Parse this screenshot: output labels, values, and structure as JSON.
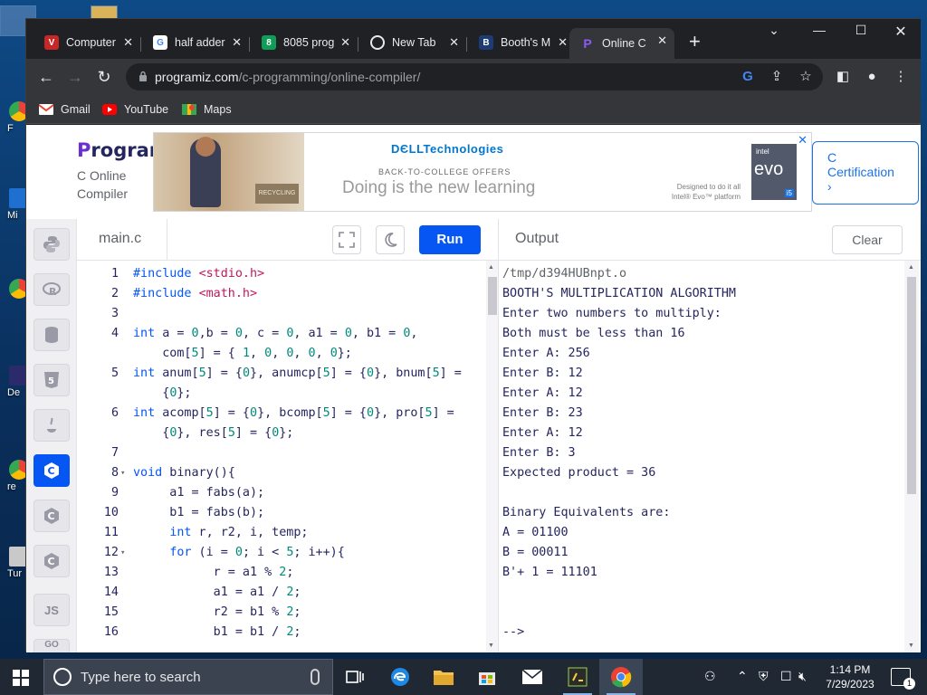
{
  "desktop": {
    "icon_labels": [
      "F",
      "Mi",
      "De",
      "re",
      "Tur"
    ]
  },
  "tabs": [
    {
      "label": "Computer",
      "favicon": "V",
      "color": "#d93025"
    },
    {
      "label": "half adder",
      "favicon": "G",
      "color": "#4285f4"
    },
    {
      "label": "8085 prog",
      "favicon": "8",
      "color": "#0f9d58"
    },
    {
      "label": "New Tab",
      "favicon": "chrome",
      "color": "#e8eaed"
    },
    {
      "label": "Booth's M",
      "favicon": "B",
      "color": "#1f3b73"
    },
    {
      "label": "Online C C",
      "favicon": "P",
      "color": "#6a2fd1"
    }
  ],
  "address": {
    "domain": "programiz.com",
    "path": "/c-programming/online-compiler/"
  },
  "bookmarks": [
    {
      "label": "Gmail"
    },
    {
      "label": "YouTube"
    },
    {
      "label": "Maps"
    }
  ],
  "brand": {
    "logo_p": "P",
    "logo_rest": "rogramiz",
    "subtitle_1": "C Online",
    "subtitle_2": "Compiler"
  },
  "ad": {
    "brand": "DЄLLTechnologies",
    "offer": "BACK-TO-COLLEGE OFFERS",
    "headline": "Doing is the new learning",
    "small_1": "Designed to do it all",
    "small_2": "Intel® Evo™ platform",
    "badge_intel": "intel",
    "badge_word": "evo",
    "badge_chip": "i5",
    "recycling": "RECYCLING"
  },
  "certification": {
    "line1": "C",
    "line2": "Certification",
    "arrow": "›"
  },
  "editor": {
    "filename": "main.c",
    "run_label": "Run"
  },
  "output": {
    "title": "Output",
    "clear_label": "Clear",
    "lines": [
      "/tmp/d394HUBnpt.o",
      "BOOTH'S MULTIPLICATION ALGORITHM",
      "Enter two numbers to multiply:",
      "Both must be less than 16",
      "Enter A: 256",
      "Enter B: 12",
      "Enter A: 12",
      "Enter B: 23",
      "Enter A: 12",
      "Enter B: 3",
      "Expected product = 36",
      "",
      "Binary Equivalents are:",
      "A = 01100",
      "B = 00011",
      "B'+ 1 = 11101",
      "",
      "",
      "-->"
    ]
  },
  "code": {
    "lines": [
      {
        "n": "1",
        "text": "#include <stdio.h>"
      },
      {
        "n": "2",
        "text": "#include <math.h>"
      },
      {
        "n": "3",
        "text": ""
      },
      {
        "n": "4",
        "text": "int a = 0,b = 0, c = 0, a1 = 0, b1 = 0,"
      },
      {
        "n": "",
        "text": "    com[5] = { 1, 0, 0, 0, 0};"
      },
      {
        "n": "5",
        "text": "int anum[5] = {0}, anumcp[5] = {0}, bnum[5] ="
      },
      {
        "n": "",
        "text": "    {0};"
      },
      {
        "n": "6",
        "text": "int acomp[5] = {0}, bcomp[5] = {0}, pro[5] ="
      },
      {
        "n": "",
        "text": "    {0}, res[5] = {0};"
      },
      {
        "n": "7",
        "text": ""
      },
      {
        "n": "8",
        "text": "void binary(){"
      },
      {
        "n": "9",
        "text": "     a1 = fabs(a);"
      },
      {
        "n": "10",
        "text": "     b1 = fabs(b);"
      },
      {
        "n": "11",
        "text": "     int r, r2, i, temp;"
      },
      {
        "n": "12",
        "text": "     for (i = 0; i < 5; i++){"
      },
      {
        "n": "13",
        "text": "           r = a1 % 2;"
      },
      {
        "n": "14",
        "text": "           a1 = a1 / 2;"
      },
      {
        "n": "15",
        "text": "           r2 = b1 % 2;"
      },
      {
        "n": "16",
        "text": "           b1 = b1 / 2;"
      }
    ]
  },
  "languages": [
    "python",
    "r",
    "sql",
    "html5",
    "java",
    "c",
    "cplusplus",
    "csharp",
    "js",
    "go"
  ],
  "taskbar": {
    "search_placeholder": "Type here to search",
    "time": "1:14 PM",
    "date": "7/29/2023",
    "notification_count": "1"
  }
}
